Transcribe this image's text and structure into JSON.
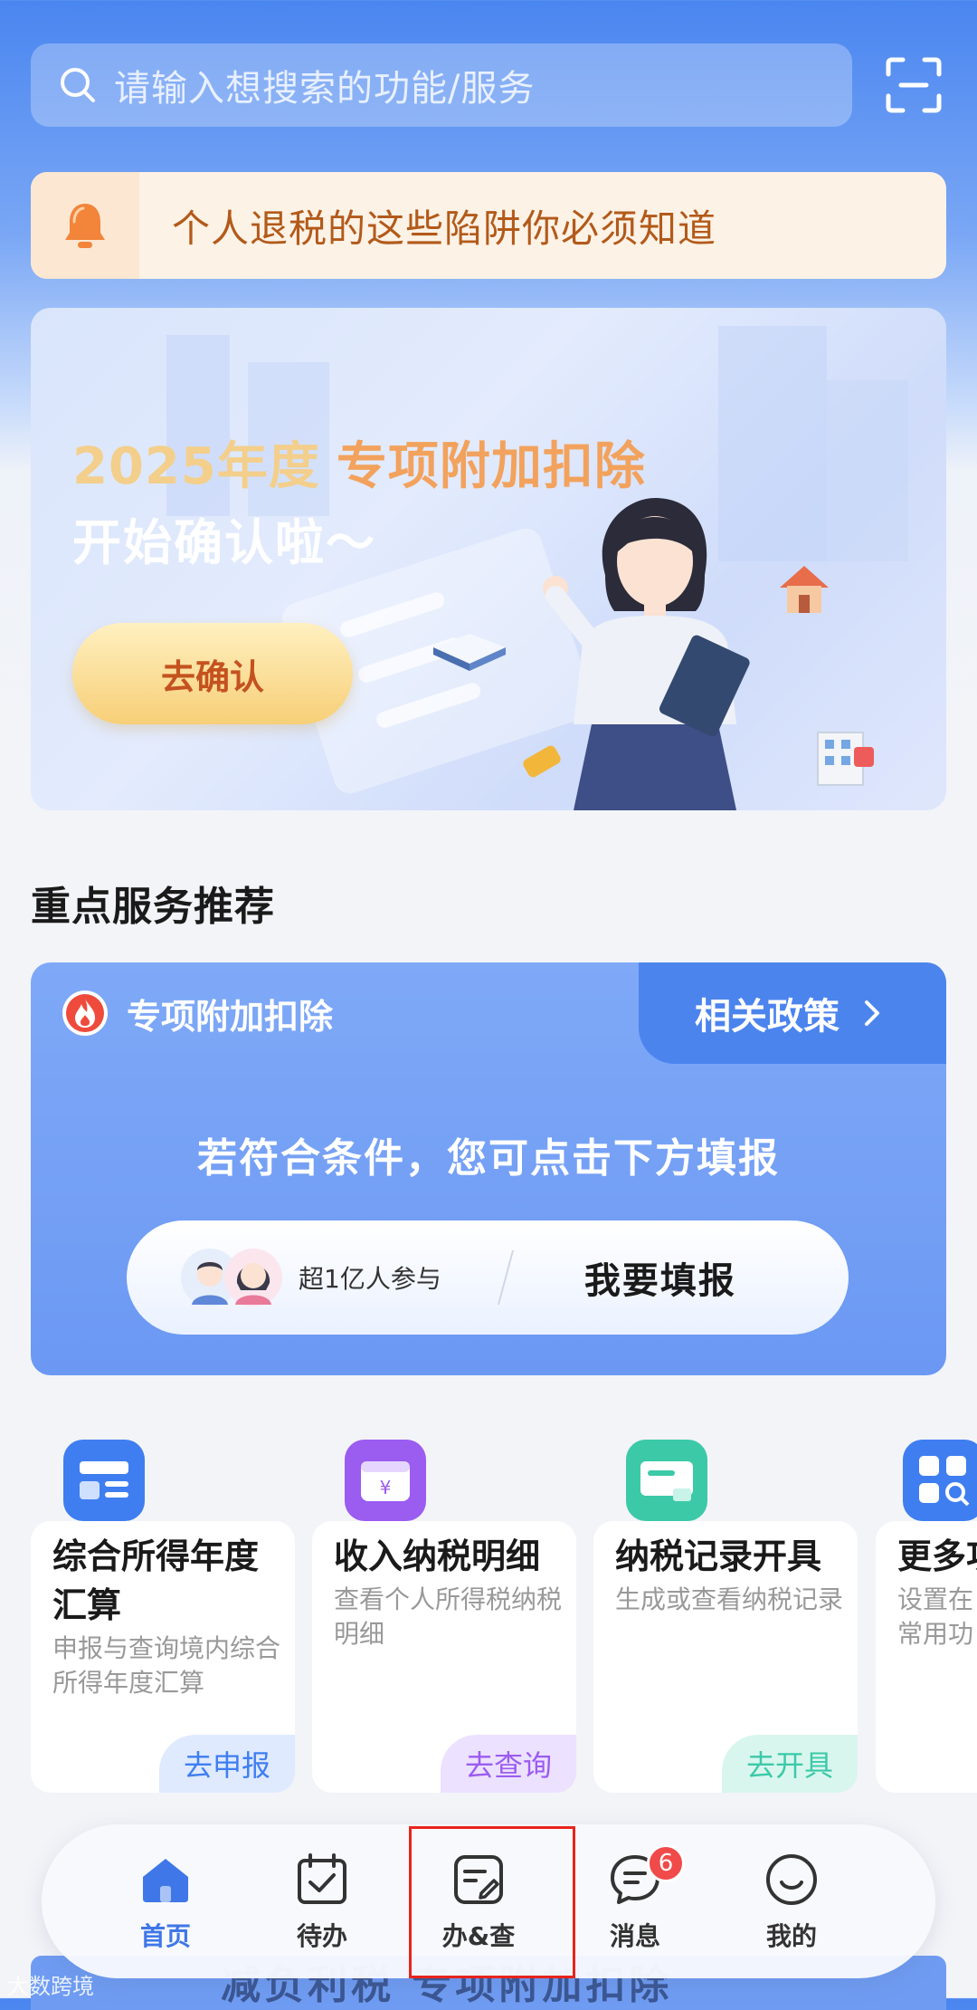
{
  "search": {
    "placeholder": "请输入想搜索的功能/服务"
  },
  "notice": {
    "text": "个人退税的这些陷阱你必须知道"
  },
  "banner": {
    "year_text": "2025年度",
    "highlight_text": "专项附加扣除",
    "subtitle": "开始确认啦～",
    "cta": "去确认"
  },
  "section": {
    "title": "重点服务推荐"
  },
  "feature": {
    "title": "专项附加扣除",
    "policy_link": "相关政策",
    "subtitle": "若符合条件，您可点击下方填报",
    "participants": "超1亿人参与",
    "action": "我要填报"
  },
  "services": [
    {
      "title": "综合所得年度汇算",
      "desc": "申报与查询境内综合所得年度汇算",
      "button": "去申报",
      "color": "#3f7ef0"
    },
    {
      "title": "收入纳税明细",
      "desc": "查看个人所得税纳税明细",
      "button": "去查询",
      "color": "#9b5cf0"
    },
    {
      "title": "纳税记录开具",
      "desc": "生成或查看纳税记录",
      "button": "去开具",
      "color": "#3cc9a8"
    },
    {
      "title": "更多功",
      "desc": "设置在常用功",
      "button": "",
      "color": "#3f7ef0"
    }
  ],
  "nav": {
    "items": [
      {
        "label": "首页",
        "icon": "home-icon",
        "active": true
      },
      {
        "label": "待办",
        "icon": "calendar-check-icon"
      },
      {
        "label": "办&查",
        "icon": "document-edit-icon"
      },
      {
        "label": "消息",
        "icon": "message-icon",
        "badge": "6"
      },
      {
        "label": "我的",
        "icon": "smile-icon"
      }
    ]
  },
  "peek": {
    "text": "减负利税 专项附加扣除"
  },
  "watermark": "大数跨境",
  "colors": {
    "accent": "#3f77e8",
    "badge": "#f04a4a",
    "highlight_box": "#e8241c"
  }
}
